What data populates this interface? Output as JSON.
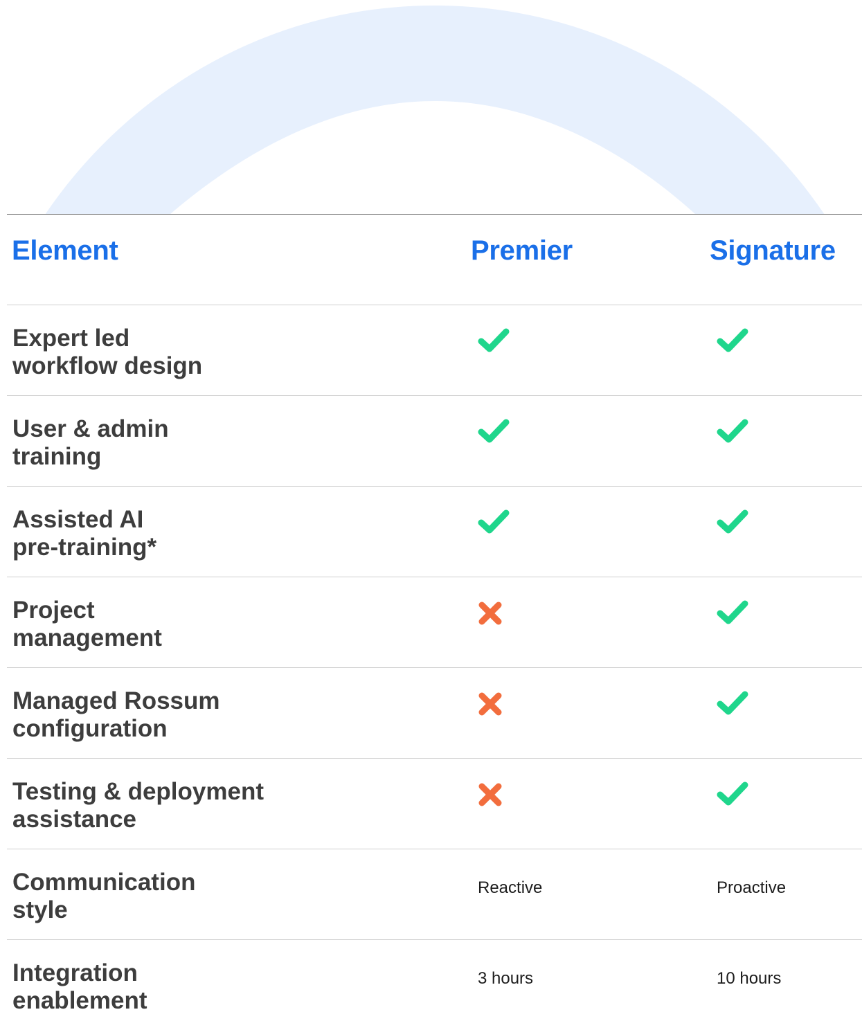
{
  "header": {
    "element": "Element",
    "premier": "Premier",
    "signature": "Signature"
  },
  "colors": {
    "heading": "#1a6fe8",
    "check": "#1fd68c",
    "cross": "#f26d3d",
    "arch": "#e7f0fd",
    "label": "#3d3d3d"
  },
  "rows": [
    {
      "label": "Expert led\nworkflow design",
      "premier": "check-icon",
      "signature": "check-icon"
    },
    {
      "label": "User & admin\ntraining",
      "premier": "check-icon",
      "signature": "check-icon"
    },
    {
      "label": "Assisted AI\npre-training*",
      "premier": "check-icon",
      "signature": "check-icon"
    },
    {
      "label": "Project\nmanagement",
      "premier": "cross-icon",
      "signature": "check-icon"
    },
    {
      "label": "Managed Rossum\nconfiguration",
      "premier": "cross-icon",
      "signature": "check-icon"
    },
    {
      "label": "Testing & deployment\nassistance",
      "premier": "cross-icon",
      "signature": "check-icon"
    },
    {
      "label": "Communication\nstyle",
      "premier_text": "Reactive",
      "signature_text": "Proactive"
    },
    {
      "label": "Integration\nenablement",
      "premier_text": "3 hours",
      "signature_text": "10 hours"
    }
  ]
}
